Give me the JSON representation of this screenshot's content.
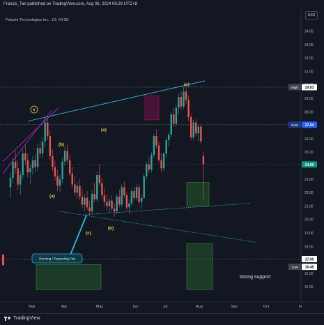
{
  "header": {
    "publisher": "Francis_Tan published on TradingView.com, Aug 06, 2024 06:29 UTC+8",
    "symbol": "Palantir Technologies Inc., 1D, NYSE",
    "currency": "USD"
  },
  "footer": {
    "brand": "TradingView"
  },
  "colors": {
    "background": "#131722",
    "up": "#26a69a",
    "down": "#ef5350",
    "wave_label": "#f0c94a",
    "trend_line": "#26b3cf",
    "support_line": "#26b3cf",
    "purple_line": "#9c27b0",
    "green_box": "#1b5e20",
    "pink_box": "#6b1d3a"
  },
  "chart_data": {
    "type": "candlestick",
    "y_axis": {
      "range": [
        15,
        35
      ],
      "ticks": [
        "34.00",
        "33.00",
        "32.00",
        "31.00",
        "30.00",
        "29.00",
        "28.00",
        "27.00",
        "26.00",
        "25.00",
        "24.00",
        "23.00",
        "22.00",
        "21.00",
        "20.00",
        "19.00",
        "18.00",
        "17.00",
        "16.00",
        "15.00"
      ]
    },
    "x_axis": {
      "ticks": [
        "Mar",
        "Apr",
        "May",
        "Jun",
        "Jul",
        "Aug",
        "Sep",
        "Oct",
        "N"
      ]
    },
    "price_labels": [
      {
        "tag": "High",
        "value": "29.83"
      },
      {
        "tag": "Post",
        "value": "27.04"
      },
      {
        "tag": "",
        "value": "24.09"
      },
      {
        "tag": "",
        "value": "17.06"
      },
      {
        "tag": "Low",
        "value": "16.48"
      }
    ],
    "wave_labels": [
      "v",
      "(b)",
      "(a)",
      "(c)",
      "(b)",
      "(a)",
      "(c)"
    ],
    "annotations": {
      "callout": "Running / Expanding Flat",
      "support": "strong support"
    },
    "candles": [
      [
        0,
        22.4,
        23.5,
        21.6,
        23.1
      ],
      [
        1,
        23.1,
        24.6,
        22.7,
        24.3
      ],
      [
        2,
        24.3,
        25.1,
        23.4,
        23.8
      ],
      [
        3,
        23.8,
        24.4,
        22.2,
        22.6
      ],
      [
        4,
        22.6,
        23.6,
        21.8,
        23.3
      ],
      [
        5,
        23.3,
        25.2,
        23.0,
        24.9
      ],
      [
        6,
        24.9,
        25.5,
        24.1,
        24.4
      ],
      [
        7,
        24.4,
        24.9,
        23.1,
        23.5
      ],
      [
        8,
        23.5,
        24.1,
        22.6,
        23.8
      ],
      [
        9,
        23.8,
        24.7,
        23.3,
        24.4
      ],
      [
        10,
        24.4,
        24.9,
        23.5,
        23.9
      ],
      [
        11,
        23.9,
        25.6,
        23.6,
        25.3
      ],
      [
        12,
        25.3,
        25.8,
        24.6,
        24.9
      ],
      [
        13,
        24.9,
        26.1,
        24.5,
        25.8
      ],
      [
        14,
        25.8,
        27.5,
        25.4,
        27.2
      ],
      [
        15,
        27.2,
        27.6,
        25.9,
        26.2
      ],
      [
        16,
        26.2,
        26.6,
        24.4,
        24.7
      ],
      [
        17,
        24.7,
        25.2,
        23.6,
        23.9
      ],
      [
        18,
        23.9,
        24.4,
        22.9,
        23.2
      ],
      [
        19,
        23.2,
        23.7,
        22.1,
        22.5
      ],
      [
        20,
        22.5,
        23.3,
        22.0,
        23.0
      ],
      [
        21,
        23.0,
        24.6,
        22.7,
        24.3
      ],
      [
        22,
        24.3,
        25.4,
        24.0,
        25.1
      ],
      [
        23,
        25.1,
        25.6,
        24.2,
        24.4
      ],
      [
        24,
        24.4,
        24.8,
        23.2,
        23.4
      ],
      [
        25,
        23.4,
        23.9,
        22.3,
        22.6
      ],
      [
        26,
        22.6,
        23.2,
        21.8,
        22.0
      ],
      [
        27,
        22.0,
        22.8,
        21.5,
        22.5
      ],
      [
        28,
        22.5,
        23.0,
        21.4,
        21.7
      ],
      [
        29,
        21.7,
        22.3,
        20.8,
        21.1
      ],
      [
        30,
        21.1,
        21.9,
        20.6,
        21.6
      ],
      [
        31,
        21.6,
        22.1,
        20.7,
        20.9
      ],
      [
        32,
        20.9,
        21.4,
        20.3,
        20.6
      ],
      [
        33,
        20.6,
        22.2,
        20.4,
        21.9
      ],
      [
        34,
        21.9,
        22.7,
        21.3,
        21.5
      ],
      [
        35,
        21.5,
        23.6,
        21.3,
        23.3
      ],
      [
        36,
        23.3,
        24.1,
        22.5,
        22.7
      ],
      [
        37,
        22.7,
        23.1,
        21.5,
        21.8
      ],
      [
        38,
        21.8,
        22.4,
        21.0,
        21.3
      ],
      [
        39,
        21.3,
        21.9,
        20.7,
        21.0
      ],
      [
        40,
        21.0,
        21.6,
        20.5,
        21.4
      ],
      [
        41,
        21.4,
        21.8,
        20.6,
        20.8
      ],
      [
        42,
        20.8,
        21.2,
        20.2,
        20.6
      ],
      [
        43,
        20.6,
        21.9,
        20.4,
        21.7
      ],
      [
        44,
        21.7,
        22.2,
        20.9,
        21.1
      ],
      [
        45,
        21.1,
        22.6,
        20.9,
        22.4
      ],
      [
        46,
        22.4,
        22.8,
        21.6,
        21.8
      ],
      [
        47,
        21.8,
        22.0,
        20.7,
        20.9
      ],
      [
        48,
        20.9,
        21.5,
        20.4,
        21.2
      ],
      [
        49,
        21.2,
        22.3,
        21.0,
        22.1
      ],
      [
        50,
        22.1,
        22.4,
        21.4,
        21.6
      ],
      [
        51,
        21.6,
        22.6,
        21.4,
        22.4
      ],
      [
        52,
        22.4,
        22.6,
        21.1,
        21.3
      ],
      [
        53,
        21.3,
        21.9,
        20.8,
        21.6
      ],
      [
        54,
        21.6,
        23.4,
        21.5,
        23.2
      ],
      [
        55,
        23.2,
        24.3,
        23.0,
        24.1
      ],
      [
        56,
        24.1,
        24.6,
        23.5,
        23.7
      ],
      [
        57,
        23.7,
        25.0,
        23.5,
        24.8
      ],
      [
        58,
        24.8,
        26.4,
        24.6,
        26.2
      ],
      [
        59,
        26.2,
        26.7,
        25.3,
        25.5
      ],
      [
        60,
        25.5,
        25.8,
        24.2,
        24.4
      ],
      [
        61,
        24.4,
        24.9,
        23.5,
        23.8
      ],
      [
        62,
        23.8,
        25.0,
        23.6,
        24.9
      ],
      [
        63,
        24.9,
        26.1,
        24.6,
        25.9
      ],
      [
        64,
        25.9,
        26.5,
        25.4,
        26.3
      ],
      [
        65,
        26.3,
        28.0,
        26.1,
        27.8
      ],
      [
        66,
        27.8,
        28.3,
        26.9,
        27.1
      ],
      [
        67,
        27.1,
        28.5,
        26.9,
        28.3
      ],
      [
        68,
        28.3,
        29.4,
        27.8,
        29.1
      ],
      [
        69,
        29.1,
        29.6,
        28.1,
        28.4
      ],
      [
        70,
        28.4,
        29.8,
        28.2,
        29.5
      ],
      [
        71,
        29.5,
        29.83,
        28.6,
        28.9
      ],
      [
        72,
        28.9,
        29.2,
        27.3,
        27.6
      ],
      [
        73,
        27.6,
        27.8,
        25.9,
        26.1
      ],
      [
        74,
        26.1,
        27.4,
        25.9,
        27.2
      ],
      [
        75,
        27.2,
        27.5,
        26.2,
        26.4
      ],
      [
        76,
        26.4,
        27.1,
        25.8,
        26.9
      ],
      [
        77,
        26.9,
        27.0,
        25.6,
        25.8
      ],
      [
        78,
        24.7,
        25.0,
        21.5,
        24.09
      ]
    ]
  }
}
